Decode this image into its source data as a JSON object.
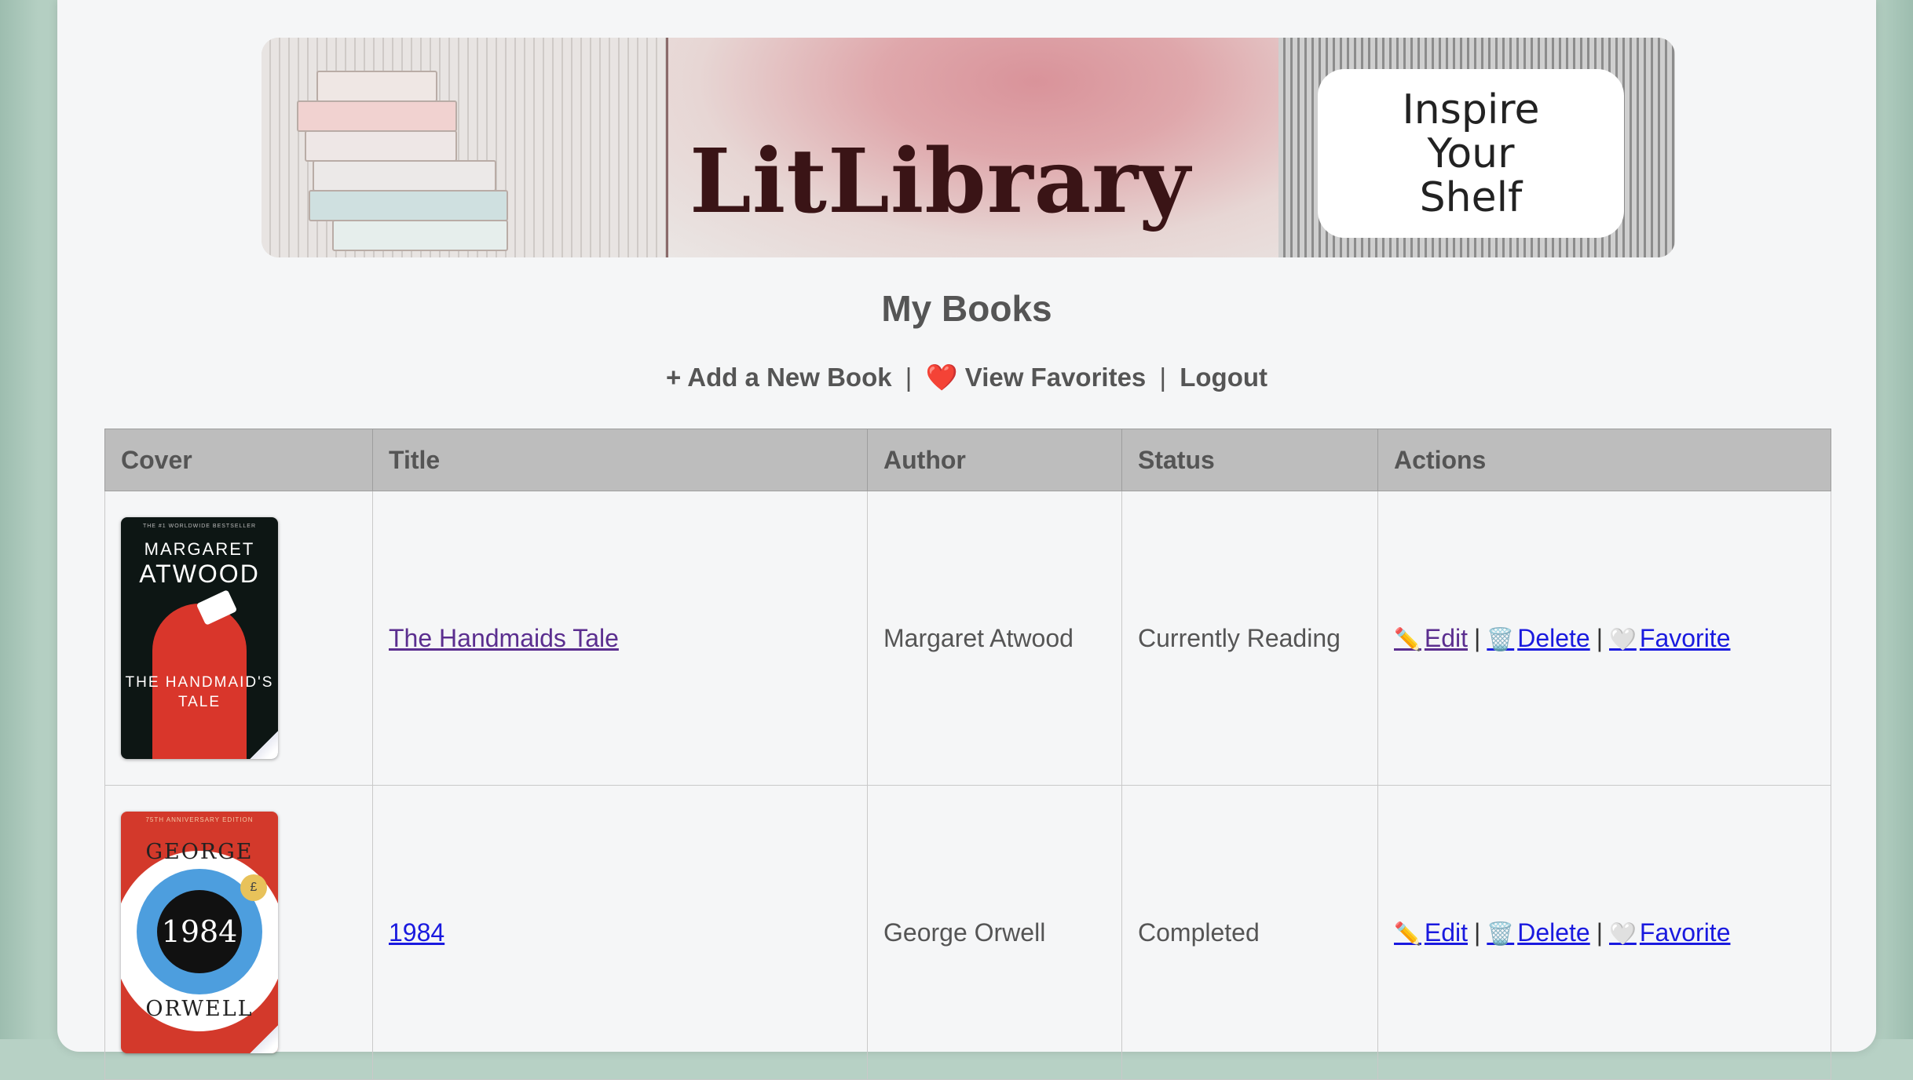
{
  "banner": {
    "brand": "LitLibrary",
    "tagline": [
      "Inspire",
      "Your",
      "Shelf"
    ]
  },
  "page": {
    "title": "My Books"
  },
  "nav": {
    "add_icon": "+",
    "add_label": "Add a New Book",
    "sep1": "|",
    "favorites_icon": "❤️",
    "favorites_label": "View Favorites",
    "sep2": "|",
    "logout_label": "Logout"
  },
  "table": {
    "headers": {
      "cover": "Cover",
      "title": "Title",
      "author": "Author",
      "status": "Status",
      "actions": "Actions"
    },
    "rows": [
      {
        "title": "The Handmaids Tale",
        "author": "Margaret Atwood",
        "status": "Currently Reading",
        "cover": {
          "top_text": "THE #1 WORLDWIDE BESTSELLER",
          "author_first": "MARGARET",
          "author_last": "ATWOOD",
          "title_lines": "THE HANDMAID'S TALE"
        }
      },
      {
        "title": "1984",
        "author": "George Orwell",
        "status": "Completed",
        "cover": {
          "top_text": "75TH ANNIVERSARY EDITION",
          "author_first": "GEORGE",
          "center": "1984",
          "author_last": "ORWELL",
          "badge": "£"
        }
      }
    ],
    "actions": {
      "edit_icon": "✏️",
      "edit_label": "Edit",
      "delete_icon": "🗑️",
      "delete_label": "Delete",
      "favorite_icon": "🤍",
      "favorite_label": "Favorite",
      "sep": "|"
    }
  },
  "colors": {
    "background": "#b7d1c5",
    "card": "#f5f6f7",
    "header_bg": "#bdbdbd",
    "link": "#1a1adf",
    "visited_link": "#5b2e8f",
    "text": "#555555"
  }
}
